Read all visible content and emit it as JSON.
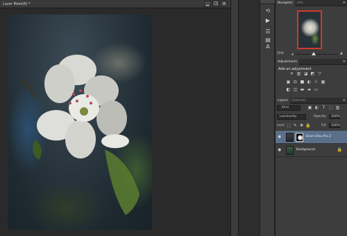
{
  "document": {
    "tab_title": "Layer Mask/8) *",
    "window_buttons": {
      "minimize": "▁",
      "restore": "❐",
      "close": "✕"
    }
  },
  "tool_strip": {
    "tools": [
      {
        "name": "history-brush-tool",
        "glyph": "⟲"
      },
      {
        "name": "actions-play-tool",
        "glyph": "▶"
      },
      {
        "name": "layer-comps-tool",
        "glyph": "☰"
      },
      {
        "name": "histogram-tool",
        "glyph": "▤"
      },
      {
        "name": "character-tool",
        "glyph": "A"
      }
    ]
  },
  "navigator": {
    "tabs": [
      "Navigator",
      "Info"
    ],
    "zoom_percent": "25%",
    "menu_glyph": "≡",
    "zoom_out_glyph": "▲",
    "zoom_in_glyph": "▲",
    "zoom_level": 0.42
  },
  "adjustments": {
    "tab": "Adjustments",
    "title": "Add an adjustment",
    "menu_glyph": "≡",
    "icons_row1": [
      "☀",
      "▥",
      "◪",
      "◩",
      "▽"
    ],
    "icons_row2": [
      "▣",
      "⚖",
      "■",
      "◐",
      "♲",
      "▦"
    ],
    "icons_row3": [
      "◧",
      "◫",
      "▬",
      "▰",
      "▭"
    ]
  },
  "layers": {
    "tabs": [
      "Layers",
      "Channels"
    ],
    "menu_glyph": "≡",
    "kind": "Kind",
    "filter_icons": [
      "▣",
      "◐",
      "T",
      "⬚",
      "▥"
    ],
    "blend_mode": "Luminosity",
    "opacity_label": "Opacity:",
    "opacity_value": "100%",
    "lock_label": "Lock:",
    "lock_icons": [
      "⬚",
      "✎",
      "✥",
      "🔒"
    ],
    "fill_label": "Fill:",
    "fill_value": "100%",
    "rows": [
      {
        "name": "Silver Efex Pro 2",
        "selected": true,
        "has_mask": true,
        "locked": false
      },
      {
        "name": "Background",
        "selected": false,
        "has_mask": false,
        "locked": true
      }
    ]
  },
  "colors": {
    "selected_layer": "#5a6f89",
    "navigator_frame": "#d13a2e",
    "panel_bg": "#3d3d3d"
  }
}
